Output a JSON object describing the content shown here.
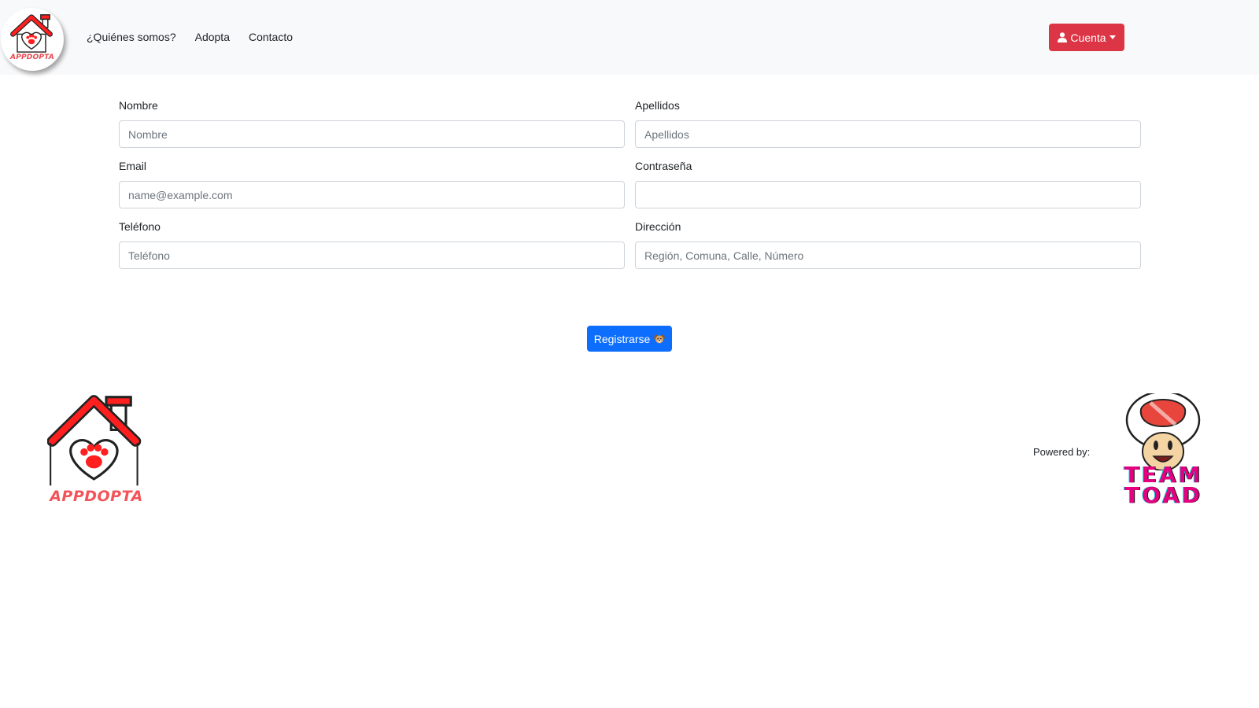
{
  "navbar": {
    "logo_text": "APPDOPTA",
    "links": [
      "¿Quiénes somos?",
      "Adopta",
      "Contacto"
    ],
    "account_label": "Cuenta"
  },
  "form": {
    "nombre": {
      "label": "Nombre",
      "placeholder": "Nombre",
      "value": ""
    },
    "apellidos": {
      "label": "Apellidos",
      "placeholder": "Apellidos",
      "value": ""
    },
    "email": {
      "label": "Email",
      "placeholder": "name@example.com",
      "value": ""
    },
    "password": {
      "label": "Contraseña",
      "placeholder": "",
      "value": ""
    },
    "telefono": {
      "label": "Teléfono",
      "placeholder": "Teléfono",
      "value": ""
    },
    "direccion": {
      "label": "Dirección",
      "placeholder": "Región, Comuna, Calle, Número",
      "value": ""
    },
    "submit_label": "Registrarse"
  },
  "footer": {
    "logo_text": "APPDOPTA",
    "powered_by": "Powered by:",
    "team_line1": "TEAM",
    "team_line2": "TOAD"
  },
  "colors": {
    "navbar_bg": "#f8f9fa",
    "account_button": "#dc3545",
    "submit_button": "#0d6efd",
    "logo_red": "#ff1f1f",
    "team_pink": "#e4007f"
  },
  "icons": {
    "account": "user-icon",
    "account_toggle": "caret-down-icon",
    "submit": "puppy-emoji-icon"
  }
}
